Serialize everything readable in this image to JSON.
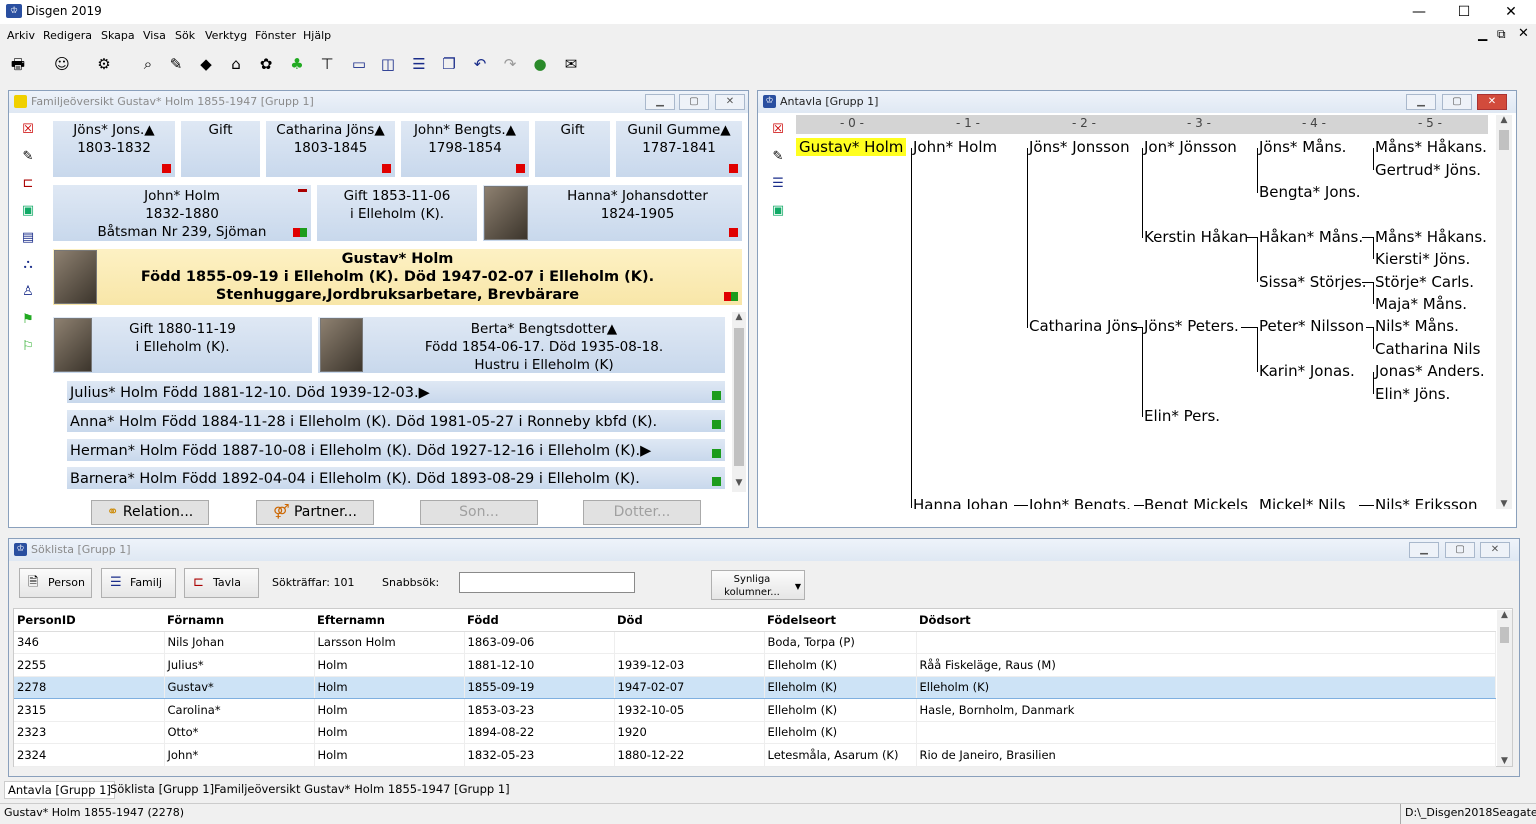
{
  "app": {
    "title": "Disgen 2019"
  },
  "window_controls": {
    "minimize": "—",
    "maximize": "☐",
    "close": "✕"
  },
  "menu": [
    "Arkiv",
    "Redigera",
    "Skapa",
    "Visa",
    "Sök",
    "Verktyg",
    "Fönster",
    "Hjälp"
  ],
  "family_window": {
    "title": "Familjeöversikt Gustav* Holm 1855-1947 [Grupp 1]",
    "grandparents": [
      {
        "name": "Jöns* Jons.▲",
        "dates": "1803-1832"
      },
      {
        "name": "Gift",
        "dates": ""
      },
      {
        "name": "Catharina Jöns▲",
        "dates": "1803-1845"
      },
      {
        "name": "John* Bengts.▲",
        "dates": "1798-1854"
      },
      {
        "name": "Gift",
        "dates": ""
      },
      {
        "name": "Gunil Gumme▲",
        "dates": "1787-1841"
      }
    ],
    "father": {
      "name": "John* Holm",
      "dates": "1832-1880",
      "occupation": "Båtsman Nr 239, Sjöman"
    },
    "parents_marriage": {
      "line1": "Gift 1853-11-06",
      "line2": "i Elleholm (K)."
    },
    "mother": {
      "name": "Hanna* Johansdotter",
      "dates": "1824-1905"
    },
    "main": {
      "name": "Gustav* Holm",
      "line1": "Född 1855-09-19 i Elleholm (K). Död 1947-02-07 i Elleholm (K).",
      "line2": "Stenhuggare,Jordbruksarbetare, Brevbärare"
    },
    "marriage": {
      "line1": "Gift 1880-11-19",
      "line2": "i Elleholm (K)."
    },
    "spouse": {
      "name": "Berta* Bengtsdotter▲",
      "line1": "Född 1854-06-17. Död 1935-08-18.",
      "line2": "Hustru  i Elleholm (K)"
    },
    "children": [
      "Julius* Holm Född 1881-12-10. Död 1939-12-03.▶",
      "Anna* Holm Född 1884-11-28 i Elleholm (K). Död 1981-05-27 i Ronneby kbfd (K).",
      "Herman* Holm Född 1887-10-08 i Elleholm (K). Död 1927-12-16 i Elleholm (K).▶",
      "Barnera* Holm Född 1892-04-04 i Elleholm (K). Död 1893-08-29 i Elleholm (K)."
    ],
    "buttons": {
      "relation": "Relation...",
      "partner": "Partner...",
      "son": "Son...",
      "dotter": "Dotter..."
    }
  },
  "antavla": {
    "title": "Antavla [Grupp 1]",
    "generations": [
      "- 0 -",
      "- 1 -",
      "- 2 -",
      "- 3 -",
      "- 4 -",
      "- 5 -"
    ],
    "people": {
      "g0": "Gustav* Holm",
      "g1a": "John* Holm",
      "g1b": "Hanna Johan",
      "g2a": "Jöns* Jonsson",
      "g2b": "Catharina Jöns",
      "g2c": "John* Bengts.",
      "g3a": "Jon* Jönsson",
      "g3b": "Kerstin Håkan",
      "g3c": "Jöns* Peters.",
      "g3d": "Elin* Pers.",
      "g3e": "Bengt Mickels",
      "g4a": "Jöns* Måns.",
      "g4b": "Bengta* Jons.",
      "g4c": "Håkan* Måns.",
      "g4d": "Sissa* Störjes.",
      "g4e": "Peter* Nilsson",
      "g4f": "Karin* Jonas.",
      "g4g": "Mickel* Nils",
      "g5a": "Måns* Håkans.",
      "g5b": "Gertrud* Jöns.",
      "g5c": "Måns* Håkans.",
      "g5d": "Kiersti* Jöns.",
      "g5e": "Störje* Carls.",
      "g5f": "Maja* Måns.",
      "g5g": "Nils* Måns.",
      "g5h": "Catharina Nils",
      "g5i": "Jonas* Anders.",
      "g5j": "Elin* Jöns.",
      "g5k": "Nils* Eriksson"
    }
  },
  "soklista": {
    "title": "Söklista [Grupp 1]",
    "buttons": {
      "person": "Person",
      "familj": "Familj",
      "tavla": "Tavla",
      "synliga": "Synliga kolumner..."
    },
    "hits_label": "Sökträffar: 101",
    "quick_label": "Snabbsök:",
    "quick_value": "",
    "columns": [
      "PersonID",
      "Förnamn",
      "Efternamn",
      "Född",
      "Död",
      "Födelseort",
      "Dödsort"
    ],
    "rows": [
      [
        "346",
        "Nils Johan",
        "Larsson Holm",
        "1863-09-06",
        "",
        "Boda, Torpa (P)",
        ""
      ],
      [
        "2255",
        "Julius*",
        "Holm",
        "1881-12-10",
        "1939-12-03",
        "Elleholm (K)",
        "Råå Fiskeläge, Raus (M)"
      ],
      [
        "2278",
        "Gustav*",
        "Holm",
        "1855-09-19",
        "1947-02-07",
        "Elleholm (K)",
        "Elleholm (K)"
      ],
      [
        "2315",
        "Carolina*",
        "Holm",
        "1853-03-23",
        "1932-10-05",
        "Elleholm (K)",
        "Hasle, Bornholm, Danmark"
      ],
      [
        "2323",
        "Otto*",
        "Holm",
        "1894-08-22",
        "1920",
        "Elleholm (K)",
        ""
      ],
      [
        "2324",
        "John*",
        "Holm",
        "1832-05-23",
        "1880-12-22",
        "Letesmåla, Asarum (K)",
        "Rio de Janeiro, Brasilien"
      ]
    ],
    "selected_row": 2
  },
  "tabs": [
    "Antavla [Grupp 1]",
    "Söklista [Grupp 1]",
    "Familjeöversikt Gustav* Holm 1855-1947 [Grupp 1]"
  ],
  "status": {
    "left": "Gustav* Holm 1855-1947 (2278)",
    "right": "D:\\_Disgen2018Seagate"
  }
}
